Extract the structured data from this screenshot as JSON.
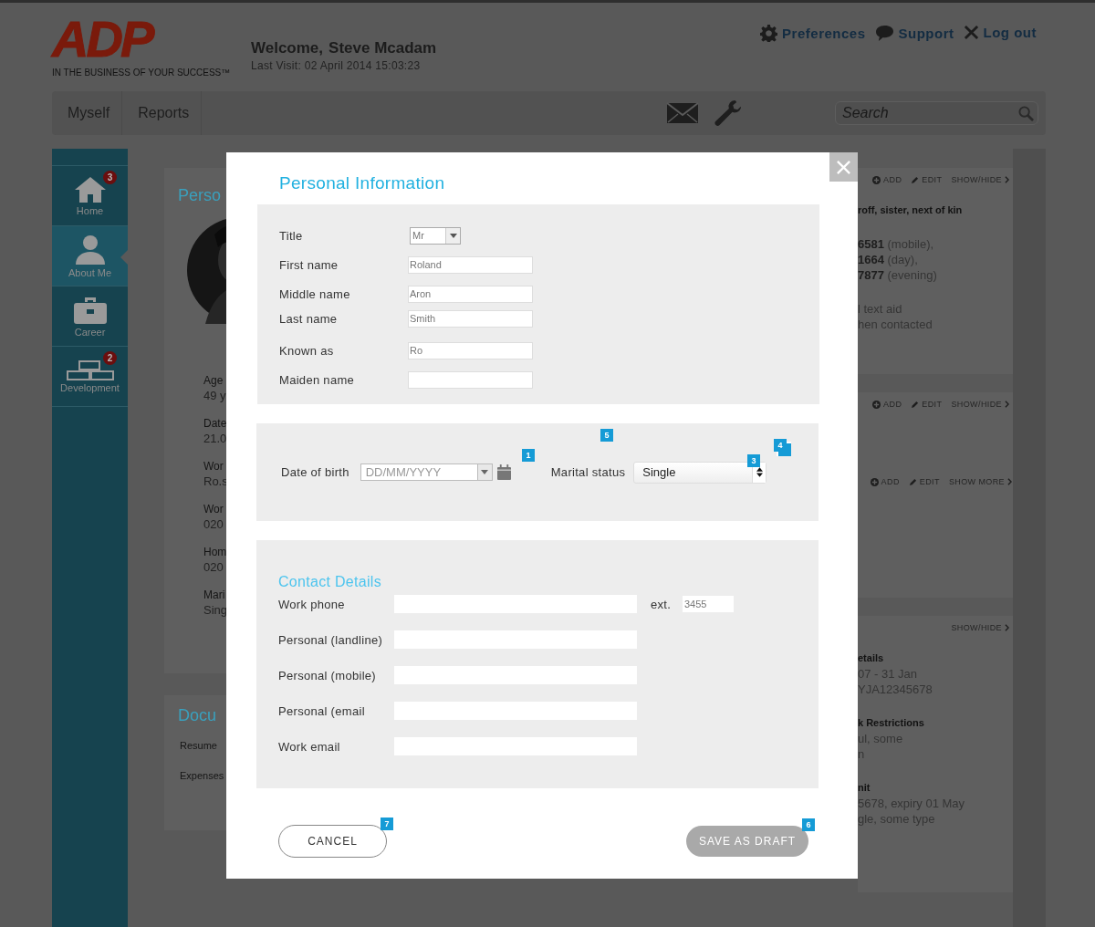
{
  "header": {
    "logo": "ADP",
    "tagline": "IN THE BUSINESS OF YOUR SUCCESS™",
    "welcome": "Welcome,",
    "user_name": "Steve Mcadam",
    "last_visit": "Last Visit: 02 April 2014 15:03:23",
    "links": [
      {
        "label": "Preferences",
        "kind": "gear"
      },
      {
        "label": "Support",
        "kind": "bubble"
      },
      {
        "label": "Log out",
        "kind": "cross"
      }
    ]
  },
  "nav": {
    "tabs": [
      {
        "label": "Myself"
      },
      {
        "label": "Reports"
      }
    ],
    "tools": [
      {
        "kind": "mail"
      },
      {
        "kind": "wrench"
      }
    ],
    "search": {
      "placeholder": "Search"
    }
  },
  "sidebar": {
    "items": [
      {
        "label": "Home",
        "kind": "house",
        "badge": "3",
        "selected": false
      },
      {
        "label": "About Me",
        "kind": "person",
        "selected": true
      },
      {
        "label": "Career",
        "kind": "briefcase",
        "selected": false
      },
      {
        "label": "Development",
        "kind": "bricks",
        "badge": "2",
        "selected": false
      }
    ]
  },
  "background": {
    "profile_card": {
      "title": "Perso",
      "fields": [
        {
          "label": "Age",
          "value": "49 y"
        },
        {
          "label": "Date",
          "value": "21.0"
        },
        {
          "label": "Wor",
          "value": "Ro.s"
        },
        {
          "label": "Wor",
          "value": "020"
        },
        {
          "label": "Hom",
          "value": "020"
        },
        {
          "label": "Mari",
          "value": "Sing"
        }
      ]
    },
    "documents_card": {
      "title": "Docu",
      "items": [
        "Resume",
        "Expenses"
      ]
    },
    "right_cards": [
      {
        "action_rows": [
          [
            {
              "label": "ADD",
              "kind": "add"
            },
            {
              "label": "EDIT",
              "kind": "edit"
            },
            {
              "label": "SHOW/HIDE",
              "kind": "toggle"
            }
          ]
        ],
        "groups": [
          [
            {
              "text": "roff, sister, next of kin",
              "kind": "label"
            }
          ],
          [
            {
              "text": "**6581** (mobile),",
              "kind": "value"
            },
            {
              "text": "**1664** (day),",
              "kind": "value"
            },
            {
              "text": "**7877** (evening)",
              "kind": "value"
            }
          ],
          [
            {
              "text": "l text aid",
              "kind": "value"
            },
            {
              "text": "hen contacted",
              "kind": "value"
            }
          ]
        ]
      },
      {
        "action_rows": [
          [
            {
              "label": "ADD",
              "kind": "add"
            },
            {
              "label": "EDIT",
              "kind": "edit"
            },
            {
              "label": "SHOW/HIDE",
              "kind": "toggle"
            }
          ],
          [
            {
              "label": "ADD",
              "kind": "add"
            },
            {
              "label": "EDIT",
              "kind": "edit"
            },
            {
              "label": "SHOW MORE",
              "kind": "toggle"
            }
          ]
        ]
      },
      {
        "action_rows": [
          [
            {
              "label": "SHOW/HIDE",
              "kind": "toggle"
            }
          ]
        ],
        "groups": [
          [
            {
              "text": "etails",
              "kind": "label"
            },
            {
              "text": "07 - 31 Jan",
              "kind": "value"
            },
            {
              "text": "YJA12345678",
              "kind": "value"
            }
          ],
          [
            {
              "text": "k Restrictions",
              "kind": "label"
            },
            {
              "text": "ul, some",
              "kind": "value"
            },
            {
              "text": "n",
              "kind": "value"
            }
          ],
          [
            {
              "text": "nit",
              "kind": "label"
            },
            {
              "text": "5678, expiry 01 May",
              "kind": "value"
            },
            {
              "text": "gle, some type",
              "kind": "value"
            }
          ]
        ]
      }
    ]
  },
  "modal": {
    "title": "Personal Information",
    "name_fields": [
      {
        "label": "Title",
        "kind": "select",
        "value": "Mr"
      },
      {
        "label": "First name",
        "kind": "text",
        "value": "Roland"
      },
      {
        "label": "Middle name",
        "kind": "text",
        "value": "Aron"
      },
      {
        "label": "Last name",
        "kind": "text",
        "value": "Smith"
      },
      {
        "label": "Known as",
        "kind": "text",
        "value": "Ro"
      },
      {
        "label": "Maiden name",
        "kind": "text"
      }
    ],
    "date_of_birth": {
      "label": "Date of birth",
      "placeholder": "DD/MM/YYYY",
      "marker": "1"
    },
    "marital_status": {
      "label": "Marital status",
      "value": "Single",
      "marker": "3",
      "label_marker": "5",
      "stack_marker": "4"
    },
    "contact": {
      "title": "Contact Details",
      "fields": [
        {
          "label": "Work phone",
          "ext_label": "ext.",
          "ext_value": "3455"
        },
        {
          "label": "Personal (landline)"
        },
        {
          "label": "Personal (mobile)"
        },
        {
          "label": "Personal (email"
        },
        {
          "label": "Work email"
        }
      ]
    },
    "buttons": [
      {
        "label": "CANCEL",
        "kind": "outline",
        "disabled": false,
        "marker": "7"
      },
      {
        "label": "SAVE AS DRAFT",
        "kind": "filled",
        "disabled": true,
        "marker": "6"
      }
    ]
  }
}
